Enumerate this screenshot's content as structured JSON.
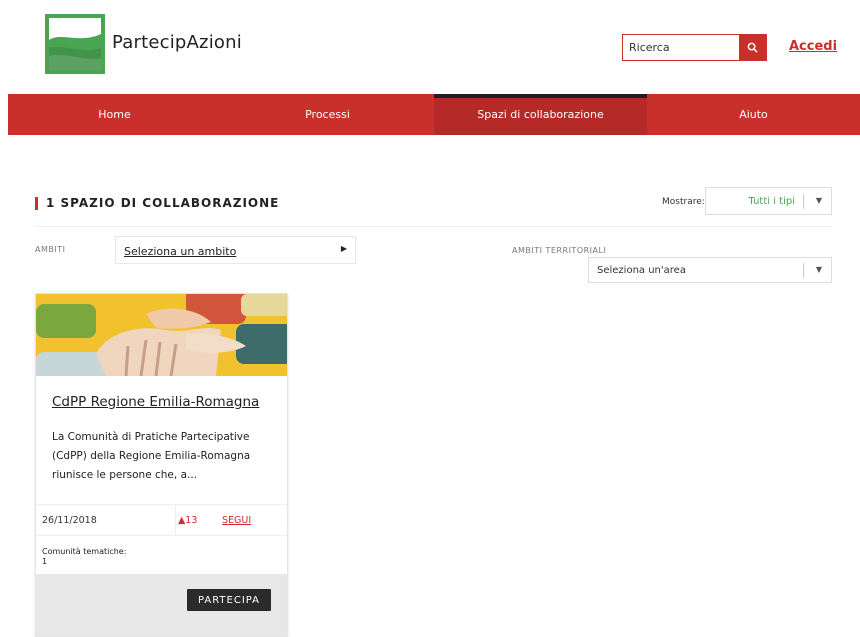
{
  "header": {
    "brand": "PartecipAzioni",
    "search": {
      "placeholder": "Ricerca"
    },
    "login": "Accedi"
  },
  "nav": {
    "items": [
      {
        "label": "Home",
        "active": false
      },
      {
        "label": "Processi",
        "active": false
      },
      {
        "label": "Spazi di collaborazione",
        "active": true
      },
      {
        "label": "Aiuto",
        "active": false
      }
    ]
  },
  "section": {
    "title": "1 SPAZIO DI COLLABORAZIONE",
    "show_label": "Mostrare:",
    "show_value": "Tutti i tipi"
  },
  "filters": {
    "ambiti_label": "AMBITI",
    "ambiti_value": "Seleziona un ambito",
    "territorial_label": "AMBITI TERRITORIALI",
    "territorial_value": "Seleziona un'area"
  },
  "card": {
    "title": "CdPP Regione Emilia-Romagna",
    "description": "La Comunità di Pratiche Partecipative (CdPP) della Regione Emilia-Romagna riunisce le persone che, a...",
    "date": "26/11/2018",
    "votes": "▲13",
    "follow": "SEGUI",
    "community_label": "Comunità tematiche:",
    "community_value": "1",
    "action": "PARTECIPA"
  },
  "colors": {
    "accent_red": "#c9302c",
    "logo_green": "#4aa552",
    "nav_active_bar": "#1f1f1f"
  },
  "icons": {
    "search": "search-icon",
    "dropdown": "chevron-down-icon",
    "ambiti_arrow": "caret-right-icon"
  }
}
